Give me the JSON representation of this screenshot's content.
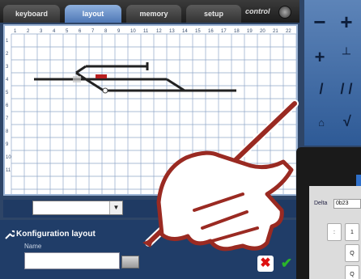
{
  "tabs": [
    {
      "label": "keyboard",
      "active": false
    },
    {
      "label": "layout",
      "active": true
    },
    {
      "label": "memory",
      "active": false
    },
    {
      "label": "setup",
      "active": false
    }
  ],
  "control": {
    "label": "control"
  },
  "grid": {
    "column_numbers": [
      "1",
      "2",
      "3",
      "4",
      "5",
      "6",
      "7",
      "8",
      "9",
      "10",
      "11",
      "12",
      "13",
      "14",
      "15",
      "16",
      "17",
      "18",
      "19",
      "20",
      "21",
      "22"
    ],
    "row_numbers": [
      "1",
      "2",
      "3",
      "4",
      "5",
      "6",
      "7",
      "8",
      "9",
      "10",
      "11"
    ]
  },
  "layout_select": {
    "value": "",
    "arrow": "▼"
  },
  "config": {
    "title": "Konfiguration layout",
    "name_label": "Name",
    "name_value": "",
    "cancel_symbol": "✖",
    "ok_symbol": "✔"
  },
  "tools": {
    "minus": "−",
    "plus_a": "+",
    "plus_b": "+",
    "t": "┴",
    "diag_a": "/",
    "diag_b": "/ /",
    "signal": "⌂",
    "curve": "√"
  },
  "overlay_window": {
    "label": "Delta",
    "field_value": "0b23",
    "keys": [
      ":",
      "1",
      "Q",
      "Q"
    ]
  },
  "colors": {
    "active_tab": "#4f78b6",
    "panel": "#203d68",
    "pen": "#9a2a22"
  }
}
